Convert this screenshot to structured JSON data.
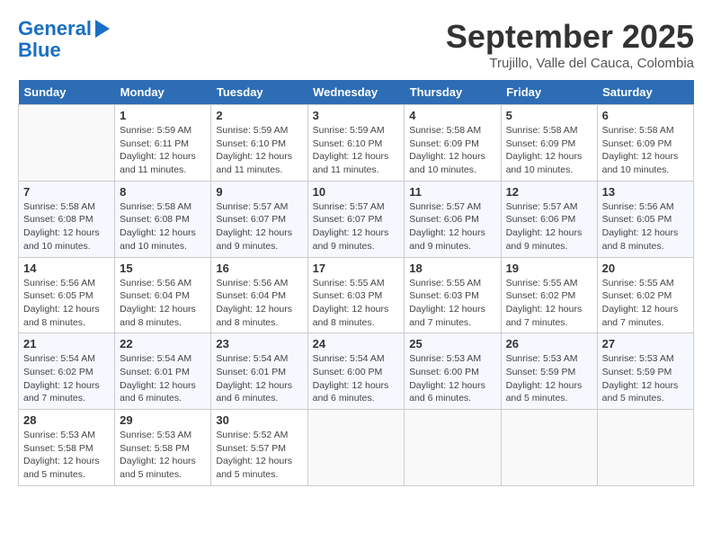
{
  "header": {
    "logo_line1": "General",
    "logo_line2": "Blue",
    "month": "September 2025",
    "location": "Trujillo, Valle del Cauca, Colombia"
  },
  "days_of_week": [
    "Sunday",
    "Monday",
    "Tuesday",
    "Wednesday",
    "Thursday",
    "Friday",
    "Saturday"
  ],
  "weeks": [
    [
      {
        "day": "",
        "info": ""
      },
      {
        "day": "1",
        "info": "Sunrise: 5:59 AM\nSunset: 6:11 PM\nDaylight: 12 hours\nand 11 minutes."
      },
      {
        "day": "2",
        "info": "Sunrise: 5:59 AM\nSunset: 6:10 PM\nDaylight: 12 hours\nand 11 minutes."
      },
      {
        "day": "3",
        "info": "Sunrise: 5:59 AM\nSunset: 6:10 PM\nDaylight: 12 hours\nand 11 minutes."
      },
      {
        "day": "4",
        "info": "Sunrise: 5:58 AM\nSunset: 6:09 PM\nDaylight: 12 hours\nand 10 minutes."
      },
      {
        "day": "5",
        "info": "Sunrise: 5:58 AM\nSunset: 6:09 PM\nDaylight: 12 hours\nand 10 minutes."
      },
      {
        "day": "6",
        "info": "Sunrise: 5:58 AM\nSunset: 6:09 PM\nDaylight: 12 hours\nand 10 minutes."
      }
    ],
    [
      {
        "day": "7",
        "info": "Sunrise: 5:58 AM\nSunset: 6:08 PM\nDaylight: 12 hours\nand 10 minutes."
      },
      {
        "day": "8",
        "info": "Sunrise: 5:58 AM\nSunset: 6:08 PM\nDaylight: 12 hours\nand 10 minutes."
      },
      {
        "day": "9",
        "info": "Sunrise: 5:57 AM\nSunset: 6:07 PM\nDaylight: 12 hours\nand 9 minutes."
      },
      {
        "day": "10",
        "info": "Sunrise: 5:57 AM\nSunset: 6:07 PM\nDaylight: 12 hours\nand 9 minutes."
      },
      {
        "day": "11",
        "info": "Sunrise: 5:57 AM\nSunset: 6:06 PM\nDaylight: 12 hours\nand 9 minutes."
      },
      {
        "day": "12",
        "info": "Sunrise: 5:57 AM\nSunset: 6:06 PM\nDaylight: 12 hours\nand 9 minutes."
      },
      {
        "day": "13",
        "info": "Sunrise: 5:56 AM\nSunset: 6:05 PM\nDaylight: 12 hours\nand 8 minutes."
      }
    ],
    [
      {
        "day": "14",
        "info": "Sunrise: 5:56 AM\nSunset: 6:05 PM\nDaylight: 12 hours\nand 8 minutes."
      },
      {
        "day": "15",
        "info": "Sunrise: 5:56 AM\nSunset: 6:04 PM\nDaylight: 12 hours\nand 8 minutes."
      },
      {
        "day": "16",
        "info": "Sunrise: 5:56 AM\nSunset: 6:04 PM\nDaylight: 12 hours\nand 8 minutes."
      },
      {
        "day": "17",
        "info": "Sunrise: 5:55 AM\nSunset: 6:03 PM\nDaylight: 12 hours\nand 8 minutes."
      },
      {
        "day": "18",
        "info": "Sunrise: 5:55 AM\nSunset: 6:03 PM\nDaylight: 12 hours\nand 7 minutes."
      },
      {
        "day": "19",
        "info": "Sunrise: 5:55 AM\nSunset: 6:02 PM\nDaylight: 12 hours\nand 7 minutes."
      },
      {
        "day": "20",
        "info": "Sunrise: 5:55 AM\nSunset: 6:02 PM\nDaylight: 12 hours\nand 7 minutes."
      }
    ],
    [
      {
        "day": "21",
        "info": "Sunrise: 5:54 AM\nSunset: 6:02 PM\nDaylight: 12 hours\nand 7 minutes."
      },
      {
        "day": "22",
        "info": "Sunrise: 5:54 AM\nSunset: 6:01 PM\nDaylight: 12 hours\nand 6 minutes."
      },
      {
        "day": "23",
        "info": "Sunrise: 5:54 AM\nSunset: 6:01 PM\nDaylight: 12 hours\nand 6 minutes."
      },
      {
        "day": "24",
        "info": "Sunrise: 5:54 AM\nSunset: 6:00 PM\nDaylight: 12 hours\nand 6 minutes."
      },
      {
        "day": "25",
        "info": "Sunrise: 5:53 AM\nSunset: 6:00 PM\nDaylight: 12 hours\nand 6 minutes."
      },
      {
        "day": "26",
        "info": "Sunrise: 5:53 AM\nSunset: 5:59 PM\nDaylight: 12 hours\nand 5 minutes."
      },
      {
        "day": "27",
        "info": "Sunrise: 5:53 AM\nSunset: 5:59 PM\nDaylight: 12 hours\nand 5 minutes."
      }
    ],
    [
      {
        "day": "28",
        "info": "Sunrise: 5:53 AM\nSunset: 5:58 PM\nDaylight: 12 hours\nand 5 minutes."
      },
      {
        "day": "29",
        "info": "Sunrise: 5:53 AM\nSunset: 5:58 PM\nDaylight: 12 hours\nand 5 minutes."
      },
      {
        "day": "30",
        "info": "Sunrise: 5:52 AM\nSunset: 5:57 PM\nDaylight: 12 hours\nand 5 minutes."
      },
      {
        "day": "",
        "info": ""
      },
      {
        "day": "",
        "info": ""
      },
      {
        "day": "",
        "info": ""
      },
      {
        "day": "",
        "info": ""
      }
    ]
  ]
}
